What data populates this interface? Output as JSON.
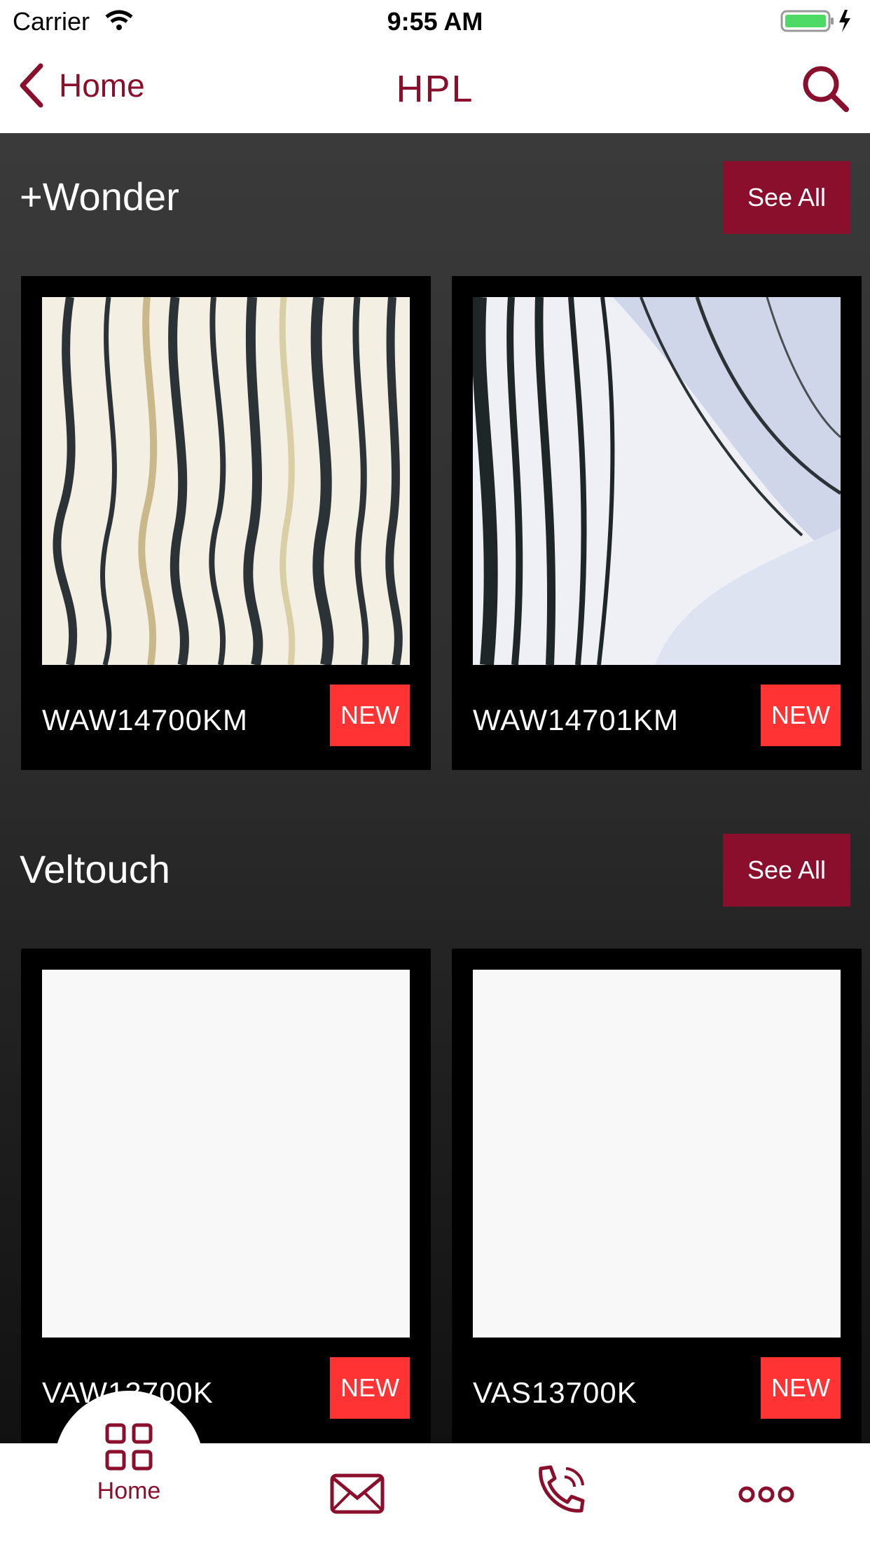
{
  "status_bar": {
    "carrier": "Carrier",
    "time": "9:55 AM"
  },
  "nav": {
    "back_label": "Home",
    "title": "HPL"
  },
  "sections": [
    {
      "title": "+Wonder",
      "see_all": "See All",
      "items": [
        {
          "code": "WAW14700KM",
          "badge": "NEW"
        },
        {
          "code": "WAW14701KM",
          "badge": "NEW"
        }
      ]
    },
    {
      "title": "Veltouch",
      "see_all": "See All",
      "items": [
        {
          "code": "VAW13700K",
          "badge": "NEW"
        },
        {
          "code": "VAS13700K",
          "badge": "NEW"
        }
      ]
    }
  ],
  "tab_bar": {
    "home_label": "Home"
  },
  "colors": {
    "accent": "#8a0f2d",
    "badge": "#ff3333"
  }
}
